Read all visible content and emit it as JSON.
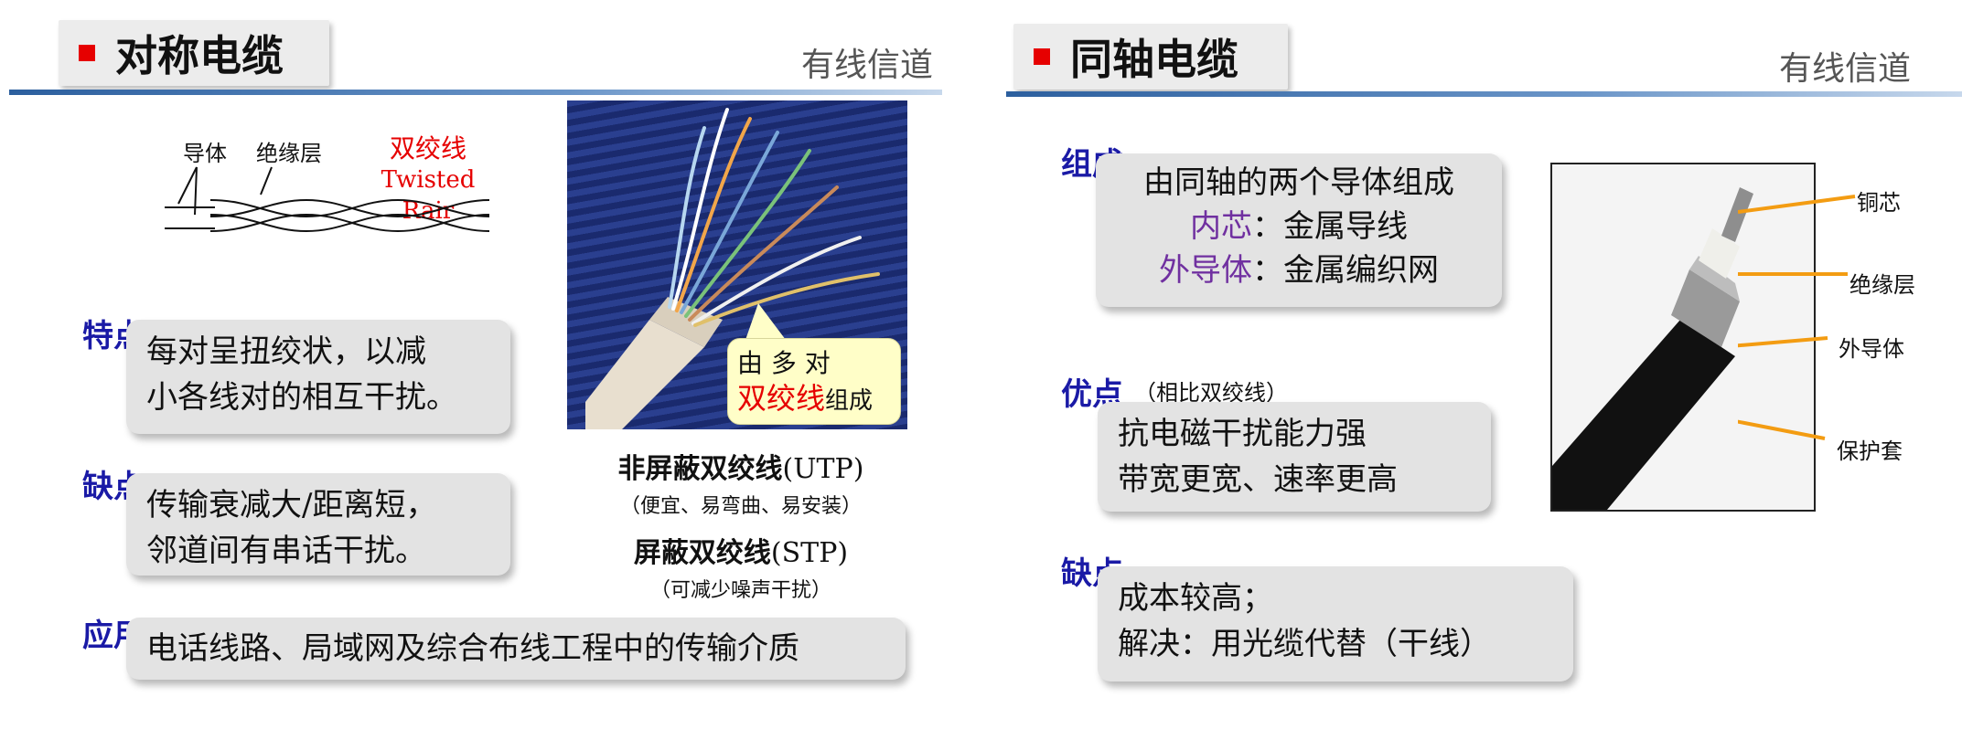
{
  "left": {
    "title": "对称电缆",
    "top_right": "有线信道",
    "diagram": {
      "conductor": "导体",
      "insulation": "绝缘层",
      "twisted_cn": "双绞线",
      "twisted_en": "Twisted Rair"
    },
    "features": {
      "label": "特点",
      "line1": "每对呈扭绞状，以减",
      "line2": "小各线对的相互干扰。"
    },
    "drawbacks": {
      "label": "缺点",
      "line1": "传输衰减大/距离短，",
      "line2": "邻道间有串话干扰。"
    },
    "application": {
      "label": "应用",
      "text": "电话线路、局域网及综合布线工程中的传输介质"
    },
    "callout": {
      "line1": "由 多 对",
      "highlight": "双绞线",
      "suffix": "组成"
    },
    "utp": {
      "name": "非屏蔽双绞线",
      "abbr": "(UTP)",
      "note": "（便宜、易弯曲、易安装）"
    },
    "stp": {
      "name": "屏蔽双绞线",
      "abbr": "(STP)",
      "note": "（可减少噪声干扰）"
    }
  },
  "right": {
    "title": "同轴电缆",
    "top_right": "有线信道",
    "composition": {
      "label": "组成",
      "line1": "由同轴的两个导体组成",
      "inner_term": "内芯",
      "inner_desc": "：金属导线",
      "outer_term": "外导体",
      "outer_desc": "：金属编织网"
    },
    "advantages": {
      "label": "优点",
      "note": "（相比双绞线）",
      "line1": "抗电磁干扰能力强",
      "line2": "带宽更宽、速率更高"
    },
    "drawbacks": {
      "label": "缺点",
      "line1": "成本较高；",
      "line2": "解决：用光缆代替（干线）"
    },
    "coax_labels": {
      "core": "铜芯",
      "insulation": "绝缘层",
      "outer_conductor": "外导体",
      "jacket": "保护套"
    }
  },
  "colors": {
    "accent_red": "#e60000",
    "label_blue": "#1a1aa6",
    "term_purple": "#7030a0",
    "callout_line": "#f39c12"
  }
}
